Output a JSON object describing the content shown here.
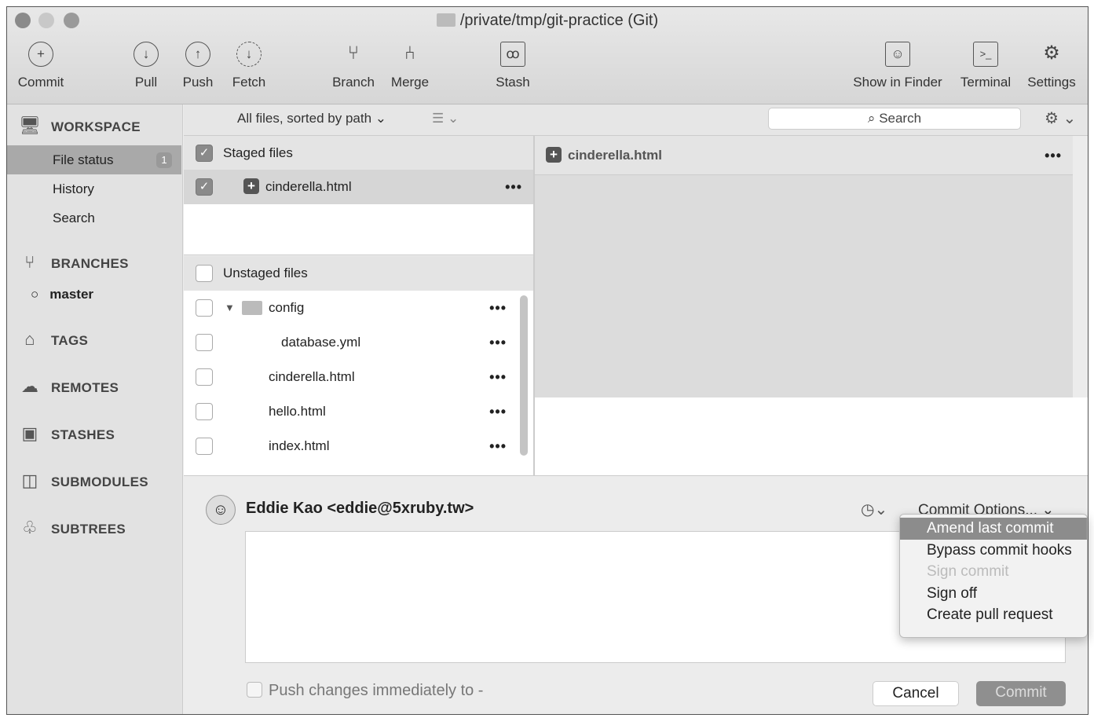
{
  "window": {
    "title": "/private/tmp/git-practice (Git)"
  },
  "toolbar": [
    {
      "label": "Commit",
      "icon": "+"
    },
    {
      "label": "Pull",
      "icon": "↓"
    },
    {
      "label": "Push",
      "icon": "↑"
    },
    {
      "label": "Fetch",
      "icon": "↓"
    },
    {
      "label": "Branch",
      "icon": "⑂"
    },
    {
      "label": "Merge",
      "icon": "⑃"
    },
    {
      "label": "Stash",
      "icon": "ꝏ"
    },
    {
      "label": "Show in Finder",
      "icon": "☺"
    },
    {
      "label": "Terminal",
      "icon": ">_"
    },
    {
      "label": "Settings",
      "icon": "⚙"
    }
  ],
  "sidebar": {
    "workspace": "WORKSPACE",
    "items": [
      {
        "label": "File status",
        "badge": "1"
      },
      {
        "label": "History"
      },
      {
        "label": "Search"
      }
    ],
    "branches": "BRANCHES",
    "current_branch": "master",
    "tags": "TAGS",
    "remotes": "REMOTES",
    "stashes": "STASHES",
    "submodules": "SUBMODULES",
    "subtrees": "SUBTREES"
  },
  "filter": {
    "sort": "All files, sorted by path",
    "search_placeholder": "Search"
  },
  "staged": {
    "header": "Staged files",
    "files": [
      "cinderella.html"
    ]
  },
  "unstaged": {
    "header": "Unstaged files",
    "files": [
      {
        "name": "config",
        "folder": true
      },
      {
        "name": "database.yml",
        "indent": true
      },
      {
        "name": "cinderella.html"
      },
      {
        "name": "hello.html"
      },
      {
        "name": "index.html"
      }
    ]
  },
  "diff": {
    "file": "cinderella.html"
  },
  "commit": {
    "author": "Eddie Kao <eddie@5xruby.tw>",
    "options": "Commit Options...",
    "push_label": "Push changes immediately to -",
    "cancel": "Cancel",
    "commit": "Commit"
  },
  "menu": [
    {
      "label": "Amend last commit",
      "state": "highlighted"
    },
    {
      "label": "Bypass commit hooks"
    },
    {
      "label": "Sign commit",
      "state": "disabled"
    },
    {
      "label": "Sign off"
    },
    {
      "label": "Create pull request"
    }
  ]
}
